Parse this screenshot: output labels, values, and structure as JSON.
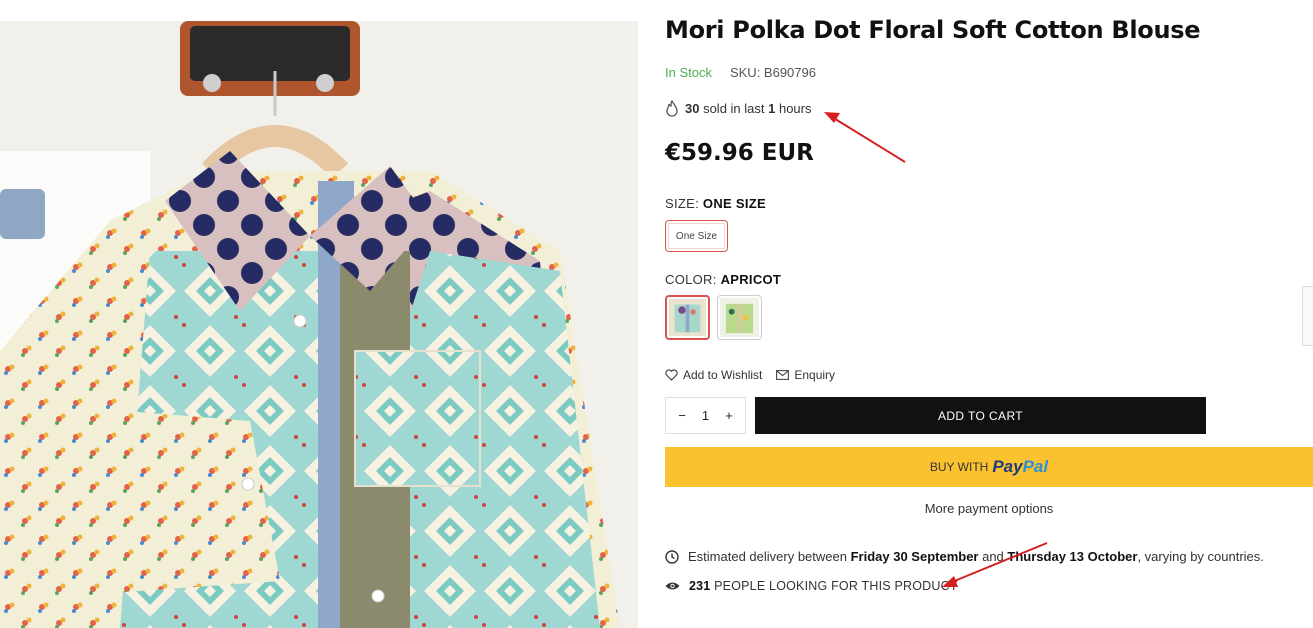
{
  "product": {
    "title": "Mori Polka Dot Floral Soft Cotton Blouse",
    "stock_status": "In Stock",
    "sku": "SKU: B690796",
    "sold_count": "30",
    "sold_text_1": " sold in last ",
    "sold_hours": "1",
    "sold_text_2": " hours",
    "price": "€59.96 EUR"
  },
  "size": {
    "label": "SIZE: ",
    "selected": "ONE SIZE",
    "option": "One Size"
  },
  "color": {
    "label": "COLOR: ",
    "selected": "APRICOT"
  },
  "actions": {
    "wishlist": "Add to Wishlist",
    "enquiry": "Enquiry",
    "qty_minus": "−",
    "qty_value": "1",
    "qty_plus": "+",
    "add_to_cart": "ADD TO CART",
    "buy_with": "BUY WITH",
    "paypal_1": "Pay",
    "paypal_2": "Pal",
    "more_payment": "More payment options"
  },
  "delivery": {
    "prefix": "Estimated delivery between ",
    "from": "Friday 30 September",
    "middle": " and ",
    "to": "Thursday 13 October",
    "suffix": ", varying by countries."
  },
  "viewers": {
    "count": "231",
    "text": " PEOPLE LOOKING FOR THIS PRODUCT"
  },
  "colors": {
    "in_stock": "#4caf50",
    "add_to_cart_bg": "#111111",
    "paypal_bg": "#fbc22f",
    "selected_border": "#d9534f",
    "annotation_arrow": "#d61f1f"
  }
}
